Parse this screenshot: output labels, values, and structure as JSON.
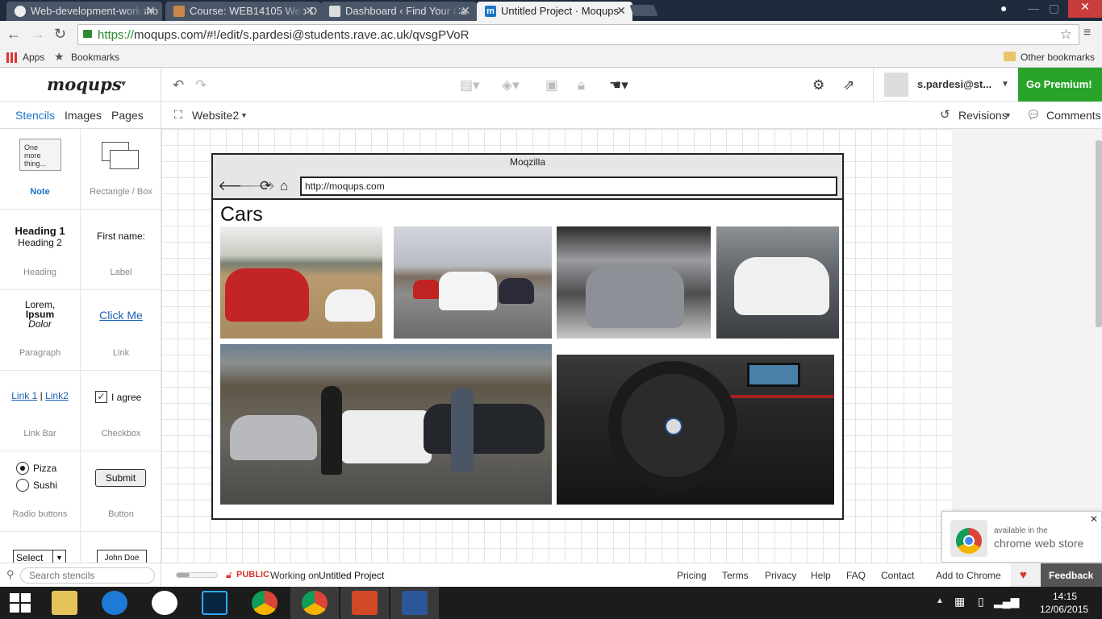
{
  "browser": {
    "tabs": [
      {
        "label": "Web-development-worksho",
        "icon": "github-icon"
      },
      {
        "label": "Course: WEB14105 Web D",
        "icon": "moodle-icon"
      },
      {
        "label": "Dashboard ‹ Find Your Ca",
        "icon": "page-icon"
      },
      {
        "label": "Untitled Project · Moqups",
        "icon": "moqups-icon",
        "active": true
      }
    ],
    "url_https": "https://",
    "url_rest": "moqups.com/#!/edit/s.pardesi@students.rave.ac.uk/qvsgPVoR",
    "bookmarks": {
      "apps": "Apps",
      "bookmarks": "Bookmarks",
      "other": "Other bookmarks"
    }
  },
  "app": {
    "logo": "moqups",
    "user_name": "s.pardesi@st...",
    "premium_label": "Go Premium!",
    "tabs": {
      "stencils": "Stencils",
      "images": "Images",
      "pages": "Pages"
    },
    "page_selector": "Website2",
    "revisions": "Revisions",
    "comments": "Comments"
  },
  "stencils": [
    {
      "name": "note",
      "caption": "Note",
      "sample": "One more thing..."
    },
    {
      "name": "rectangle",
      "caption": "Rectangle / Box"
    },
    {
      "name": "heading",
      "caption": "Heading",
      "h1": "Heading 1",
      "h2": "Heading 2"
    },
    {
      "name": "label",
      "caption": "Label",
      "sample": "First name:"
    },
    {
      "name": "paragraph",
      "caption": "Paragraph",
      "line1": "Lorem,",
      "line2": "Ipsum",
      "line3": "Dolor"
    },
    {
      "name": "link",
      "caption": "Link",
      "sample": "Click Me"
    },
    {
      "name": "link-bar",
      "caption": "Link Bar",
      "link1": "Link 1",
      "sep": "|",
      "link2": "Link2"
    },
    {
      "name": "checkbox",
      "caption": "Checkbox",
      "sample": "I agree"
    },
    {
      "name": "radio",
      "caption": "Radio buttons",
      "opt1": "Pizza",
      "opt2": "Sushi"
    },
    {
      "name": "button",
      "caption": "Button",
      "sample": "Submit"
    },
    {
      "name": "select",
      "sample": "Select"
    },
    {
      "name": "textinput",
      "sample": "John Doe"
    }
  ],
  "search_placeholder": "Search stencils",
  "mockup": {
    "window_title": "Moqzilla",
    "url": "http://moqups.com",
    "heading": "Cars"
  },
  "status": {
    "public": "PUBLIC",
    "working_on": "Working on",
    "project": "Untitled Project",
    "links": [
      "Pricing",
      "Terms",
      "Privacy",
      "Help",
      "FAQ",
      "Contact",
      "Add to Chrome"
    ],
    "feedback": "Feedback"
  },
  "cws": {
    "line1": "available in the",
    "line2": "chrome web store"
  },
  "taskbar": {
    "time": "14:15",
    "date": "12/06/2015"
  },
  "colors": {
    "accent": "#1a73c8",
    "premium": "#2aa32a",
    "public": "#d9342b"
  }
}
